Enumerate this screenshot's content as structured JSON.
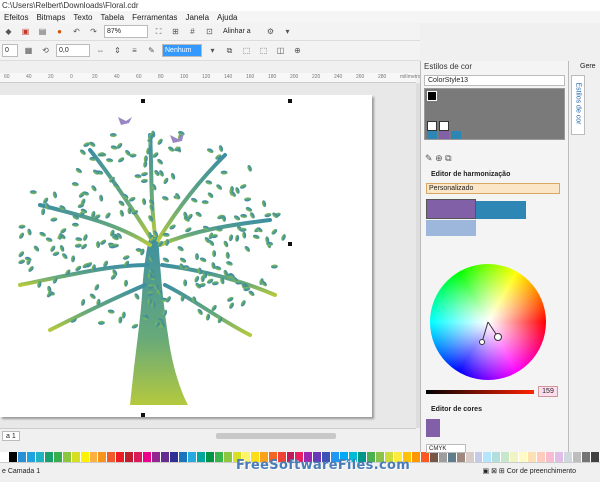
{
  "window": {
    "title": "C:\\Users\\Relbert\\Downloads\\Floral.cdr"
  },
  "menu": [
    "Efeitos",
    "Bitmaps",
    "Texto",
    "Tabela",
    "Ferramentas",
    "Janela",
    "Ajuda"
  ],
  "toolbar": {
    "zoom": "87%",
    "align_label": "Alinhar a",
    "outline": "Nenhum"
  },
  "props": {
    "x": "0",
    "y": "0",
    "angle": "0,0"
  },
  "ruler": {
    "ticks": [
      "60",
      "40",
      "20",
      "0",
      "20",
      "40",
      "60",
      "80",
      "100",
      "120",
      "140",
      "160",
      "180",
      "200",
      "220",
      "240",
      "260",
      "280",
      "milímetros"
    ]
  },
  "page_tab": "a 1",
  "docker": {
    "title": "Estilos de cor",
    "style_name": "ColorStyle13",
    "harmony_title": "Editor de harmonização",
    "harmony_mode": "Personalizado",
    "editor_title": "Editor de cores",
    "color_model": "CMYK",
    "brightness_value": "159"
  },
  "right_panel": {
    "tab_label": "Estilos de cor",
    "top_label": "Gere"
  },
  "status": {
    "layer": "e Camada 1",
    "fill_label": "Cor de preenchimento"
  },
  "watermark": "FreeSoftwareFiles.com",
  "colors": {
    "swatch_purple": "#8160a8",
    "swatch_blue": "#2e86b5",
    "swatch_lightblue": "#9cb6dc"
  },
  "palette": [
    "#ffffff",
    "#000000",
    "#2b8fd6",
    "#1fa3e0",
    "#20b3c4",
    "#1aa06a",
    "#35ae4b",
    "#8cc63f",
    "#d7df23",
    "#fff200",
    "#fbb040",
    "#f7941e",
    "#f15a29",
    "#ed1c24",
    "#be1e2d",
    "#da1c5c",
    "#ec008c",
    "#92278f",
    "#662d91",
    "#2e3192",
    "#1c75bc",
    "#27aae1",
    "#00a79d",
    "#009444",
    "#39b54a",
    "#8dc63f",
    "#d7e022",
    "#fff568",
    "#ffde17",
    "#f9a11b",
    "#f26522",
    "#ef4136",
    "#c2185b",
    "#e91e63",
    "#9c27b0",
    "#673ab7",
    "#3f51b5",
    "#2196f3",
    "#03a9f4",
    "#00bcd4",
    "#009688",
    "#4caf50",
    "#8bc34a",
    "#cddc39",
    "#ffeb3b",
    "#ffc107",
    "#ff9800",
    "#ff5722",
    "#795548",
    "#9e9e9e",
    "#607d8b",
    "#a1887f",
    "#d7ccc8",
    "#c5cae9",
    "#b3e5fc",
    "#b2dfdb",
    "#c8e6c9",
    "#f0f4c3",
    "#fff9c4",
    "#ffe0b2",
    "#ffccbc",
    "#f8bbd0",
    "#e1bee7",
    "#cfd8dc",
    "#bdbdbd",
    "#757575",
    "#424242"
  ]
}
